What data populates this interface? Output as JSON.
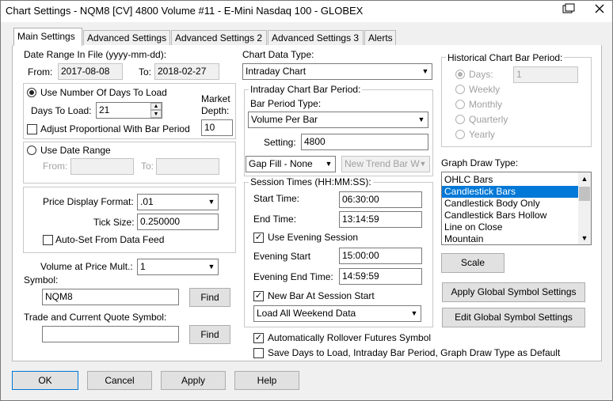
{
  "window": {
    "title": "Chart Settings - NQM8 [CV]  4800 Volume  #11 - E-Mini Nasdaq 100 - GLOBEX",
    "restore_icon": "restore-window-icon",
    "close_icon": "close-icon"
  },
  "tabs": [
    "Main Settings",
    "Advanced Settings",
    "Advanced Settings 2",
    "Advanced Settings 3",
    "Alerts"
  ],
  "date_range": {
    "label": "Date Range In File (yyyy-mm-dd):",
    "from_label": "From:",
    "from_value": "2017-08-08",
    "to_label": "To:",
    "to_value": "2018-02-27"
  },
  "days_group": {
    "use_days_label": "Use Number Of Days To Load",
    "days_to_load_label": "Days To Load:",
    "days_to_load_value": "21",
    "market_depth_label_1": "Market",
    "market_depth_label_2": "Depth:",
    "market_depth_value": "10",
    "adjust_label": "Adjust Proportional With Bar Period"
  },
  "date_range_group": {
    "use_date_range_label": "Use Date Range",
    "from_label": "From:",
    "to_label": "To:"
  },
  "price_group": {
    "price_format_label": "Price Display Format:",
    "price_format_value": ".01",
    "tick_size_label": "Tick Size:",
    "tick_size_value": "0.250000",
    "auto_set_label": "Auto-Set From Data Feed"
  },
  "volume": {
    "label": "Volume at Price Mult.:",
    "value": "1"
  },
  "symbol": {
    "label": "Symbol:",
    "value": "NQM8",
    "find_label": "Find"
  },
  "trade_symbol": {
    "label": "Trade and Current Quote Symbol:",
    "value": "",
    "find_label": "Find"
  },
  "chart_data_type": {
    "label": "Chart Data Type:",
    "value": "Intraday Chart"
  },
  "intraday": {
    "group_label": "Intraday Chart Bar Period:",
    "bar_period_type_label": "Bar Period Type:",
    "bar_period_type_value": "Volume Per Bar",
    "setting_label": "Setting:",
    "setting_value": "4800",
    "gap_fill_value": "Gap Fill - None",
    "new_trend_value": "New Trend Bar W"
  },
  "session": {
    "group_label": "Session Times (HH:MM:SS):",
    "start_label": "Start Time:",
    "start_value": "06:30:00",
    "end_label": "End Time:",
    "end_value": "13:14:59",
    "use_evening_label": "Use Evening Session",
    "evening_start_label": "Evening Start",
    "evening_start_value": "15:00:00",
    "evening_end_label": "Evening End Time:",
    "evening_end_value": "14:59:59",
    "new_bar_label": "New Bar At Session Start",
    "weekend_value": "Load All Weekend Data"
  },
  "rollover_label": "Automatically Rollover Futures Symbol",
  "save_default_label": "Save Days to Load, Intraday Bar Period, Graph Draw Type as Default",
  "historical": {
    "group_label": "Historical Chart Bar Period:",
    "days_label": "Days:",
    "days_value": "1",
    "weekly_label": "Weekly",
    "monthly_label": "Monthly",
    "quarterly_label": "Quarterly",
    "yearly_label": "Yearly"
  },
  "graph_draw": {
    "label": "Graph Draw Type:",
    "items": [
      "OHLC Bars",
      "Candlestick Bars",
      "Candlestick Body Only",
      "Candlestick Bars Hollow",
      "Line on Close",
      "Mountain"
    ],
    "selected": "Candlestick Bars"
  },
  "buttons": {
    "scale": "Scale",
    "apply_global": "Apply Global Symbol Settings",
    "edit_global": "Edit Global Symbol Settings",
    "ok": "OK",
    "cancel": "Cancel",
    "apply": "Apply",
    "help": "Help"
  },
  "colors": {
    "selection": "#0078d7",
    "panel": "#ffffff",
    "window": "#f0f0f0"
  }
}
